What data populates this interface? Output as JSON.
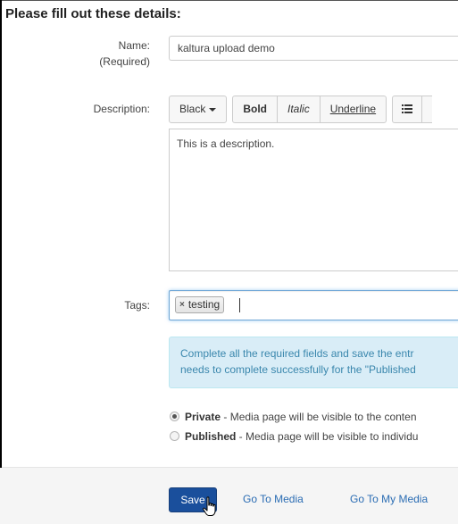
{
  "form": {
    "heading": "Please fill out these details:",
    "name": {
      "label": "Name:",
      "required_note": "(Required)",
      "value": "kaltura upload demo"
    },
    "description": {
      "label": "Description:",
      "toolbar": {
        "color_label": "Black",
        "bold_label": "Bold",
        "italic_label": "Italic",
        "underline_label": "Underline",
        "list_icon": "list-icon"
      },
      "value": "This is a description."
    },
    "tags": {
      "label": "Tags:",
      "items": [
        "testing"
      ]
    },
    "alert": {
      "line1": "Complete all the required fields and save the entr",
      "line2": "needs to complete successfully for the \"Published"
    },
    "privacy": {
      "private": {
        "title": "Private",
        "desc": " - Media page will be visible to the conten",
        "checked": true
      },
      "published": {
        "title": "Published",
        "desc": " - Media page will be visible to individu",
        "checked": false
      }
    }
  },
  "footer": {
    "save_label": "Save",
    "go_to_media_label": "Go To Media",
    "go_to_my_media_label": "Go To My Media"
  },
  "colors": {
    "primary_button": "#1a4f9c",
    "link": "#2a6cb3",
    "alert_bg": "#d9edf7",
    "alert_text": "#3a87ad"
  }
}
